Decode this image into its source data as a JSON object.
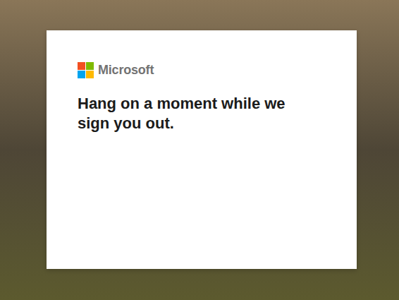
{
  "brand": {
    "name": "Microsoft"
  },
  "message": "Hang on a moment while we sign you out."
}
